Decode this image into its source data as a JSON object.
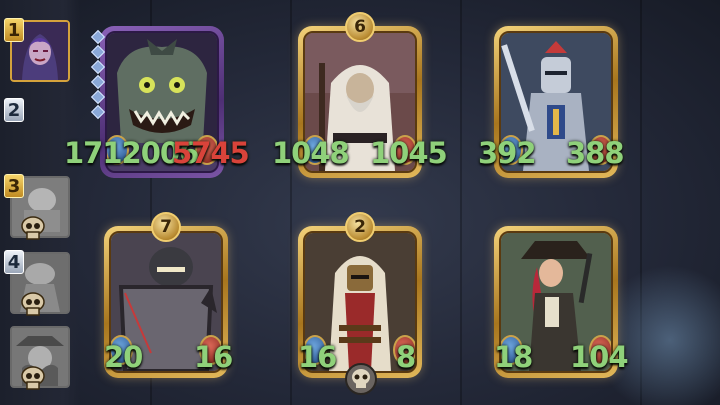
{
  "turn_order": [
    {
      "number": "1",
      "style": "gold",
      "state": "active"
    },
    {
      "number": "2",
      "style": "silver",
      "state": "empty"
    },
    {
      "number": "3",
      "style": "gold",
      "state": "dead"
    },
    {
      "number": "4",
      "style": "silver",
      "state": "dead"
    },
    {
      "number": "",
      "style": "none",
      "state": "dead"
    }
  ],
  "enemies": [
    {
      "name": "fish-brute",
      "rank": "",
      "frame": "purple",
      "attack": "1712006",
      "health": "5745",
      "attack_color": "green",
      "health_color": "red"
    },
    {
      "name": "hooded-monk",
      "rank": "6",
      "frame": "gold",
      "attack": "1048",
      "health": "1045"
    },
    {
      "name": "armored-knight",
      "rank": "",
      "frame": "gold",
      "attack": "392",
      "health": "388"
    }
  ],
  "allies": [
    {
      "name": "shield-knight",
      "rank": "7",
      "frame": "gold",
      "attack": "20",
      "health": "16"
    },
    {
      "name": "crimson-templar",
      "rank": "2",
      "frame": "gold",
      "attack": "16",
      "health": "8"
    },
    {
      "name": "pirate-gunner",
      "rank": "",
      "frame": "gold",
      "attack": "18",
      "health": "104"
    }
  ],
  "colors": {
    "stat_green": "#8fd17a",
    "stat_red": "#d9433a",
    "gold_frame": "#d4a53f",
    "purple_frame": "#6b4a96"
  }
}
